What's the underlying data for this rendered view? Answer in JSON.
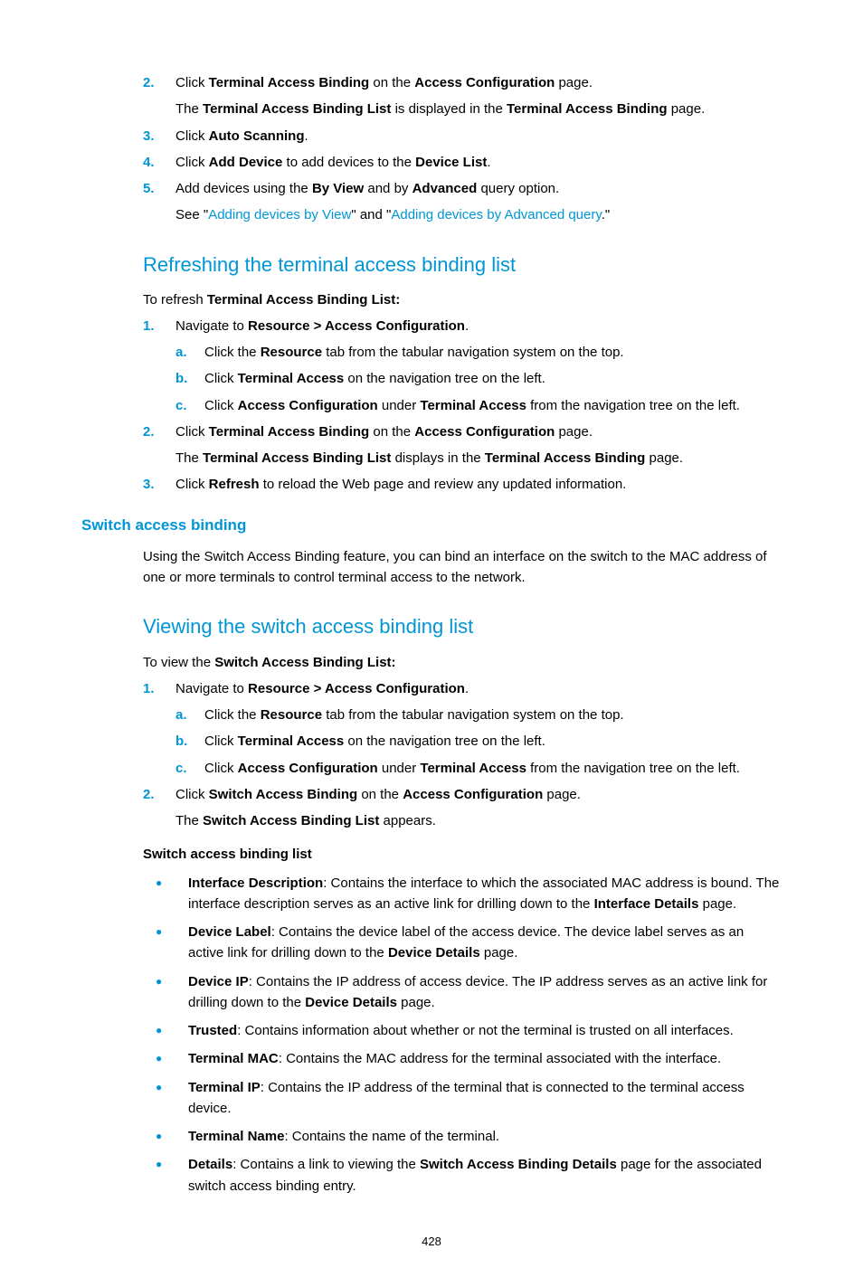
{
  "top_steps": {
    "s2": {
      "marker": "2.",
      "text_before": "Click ",
      "b1": "Terminal Access Binding",
      "text_mid": " on the ",
      "b2": "Access Configuration",
      "text_after": " page.",
      "cont_before": "The ",
      "cont_b1": "Terminal Access Binding List",
      "cont_mid": " is displayed in the ",
      "cont_b2": "Terminal Access Binding",
      "cont_after": " page."
    },
    "s3": {
      "marker": "3.",
      "text_before": "Click ",
      "b1": "Auto Scanning",
      "text_after": "."
    },
    "s4": {
      "marker": "4.",
      "text_before": "Click ",
      "b1": "Add Device",
      "text_mid": " to add devices to the ",
      "b2": "Device List",
      "text_after": "."
    },
    "s5": {
      "marker": "5.",
      "text_before": "Add devices using the ",
      "b1": "By View",
      "text_mid": " and by ",
      "b2": "Advanced",
      "text_after": " query option.",
      "cont_before": "See \"",
      "link1": "Adding devices by View",
      "cont_mid": "\" and \"",
      "link2": "Adding devices by Advanced query",
      "cont_after": ".\""
    }
  },
  "refreshing": {
    "heading": "Refreshing the terminal access binding list",
    "intro_before": "To refresh ",
    "intro_b": "Terminal Access Binding List:",
    "s1": {
      "marker": "1.",
      "text_before": "Navigate to ",
      "b1": "Resource > Access Configuration",
      "text_after": ".",
      "a": {
        "marker": "a.",
        "text_before": "Click the ",
        "b1": "Resource",
        "text_after": " tab from the tabular navigation system on the top."
      },
      "b": {
        "marker": "b.",
        "text_before": "Click ",
        "b1": "Terminal Access",
        "text_after": " on the navigation tree on the left."
      },
      "c": {
        "marker": "c.",
        "text_before": "Click ",
        "b1": "Access Configuration",
        "text_mid": " under ",
        "b2": "Terminal Access",
        "text_after": " from the navigation tree on the left."
      }
    },
    "s2": {
      "marker": "2.",
      "text_before": "Click ",
      "b1": "Terminal Access Binding",
      "text_mid": " on the ",
      "b2": "Access Configuration",
      "text_after": " page.",
      "cont_before": "The ",
      "cont_b1": "Terminal Access Binding List",
      "cont_mid": " displays in the ",
      "cont_b2": "Terminal Access Binding",
      "cont_after": " page."
    },
    "s3": {
      "marker": "3.",
      "text_before": "Click ",
      "b1": "Refresh",
      "text_after": " to reload the Web page and review any updated information."
    }
  },
  "switch_access": {
    "heading": "Switch access binding",
    "para": "Using the Switch Access Binding feature, you can bind an interface on the switch to the MAC address of one or more terminals to control terminal access to the network."
  },
  "viewing": {
    "heading": "Viewing the switch access binding list",
    "intro_before": "To view the ",
    "intro_b": "Switch Access Binding List:",
    "s1": {
      "marker": "1.",
      "text_before": "Navigate to ",
      "b1": "Resource > Access Configuration",
      "text_after": ".",
      "a": {
        "marker": "a.",
        "text_before": "Click the ",
        "b1": "Resource",
        "text_after": " tab from the tabular navigation system on the top."
      },
      "b": {
        "marker": "b.",
        "text_before": "Click ",
        "b1": "Terminal Access",
        "text_after": " on the navigation tree on the left."
      },
      "c": {
        "marker": "c.",
        "text_before": "Click ",
        "b1": "Access Configuration",
        "text_mid": " under ",
        "b2": "Terminal Access",
        "text_after": " from the navigation tree on the left."
      }
    },
    "s2": {
      "marker": "2.",
      "text_before": "Click ",
      "b1": "Switch Access Binding",
      "text_mid": " on the ",
      "b2": "Access Configuration",
      "text_after": " page.",
      "cont_before": "The ",
      "cont_b1": "Switch Access Binding List",
      "cont_after": " appears."
    },
    "list_heading": "Switch access binding list",
    "bullets": {
      "b1": {
        "term": "Interface Description",
        "desc_before": ": Contains the interface to which the associated MAC address is bound. The interface description serves as an active link for drilling down to the ",
        "desc_b": "Interface Details",
        "desc_after": " page."
      },
      "b2": {
        "term": "Device Label",
        "desc_before": ": Contains the device label of the access device. The device label serves as an active link for drilling down to the ",
        "desc_b": "Device Details",
        "desc_after": " page."
      },
      "b3": {
        "term": "Device IP",
        "desc_before": ": Contains the IP address of access device. The IP address serves as an active link for drilling down to the ",
        "desc_b": "Device Details",
        "desc_after": " page."
      },
      "b4": {
        "term": "Trusted",
        "desc": ": Contains information about whether or not the terminal is trusted on all interfaces."
      },
      "b5": {
        "term": "Terminal MAC",
        "desc": ": Contains the MAC address for the terminal associated with the interface."
      },
      "b6": {
        "term": "Terminal IP",
        "desc": ": Contains the IP address of the terminal that is connected to the terminal access device."
      },
      "b7": {
        "term": "Terminal Name",
        "desc": ": Contains the name of the terminal."
      },
      "b8": {
        "term": "Details",
        "desc_before": ": Contains a link to viewing the ",
        "desc_b": "Switch Access Binding Details",
        "desc_after": " page for the associated switch access binding entry."
      }
    }
  },
  "page_num": "428",
  "bullet_char": "●"
}
